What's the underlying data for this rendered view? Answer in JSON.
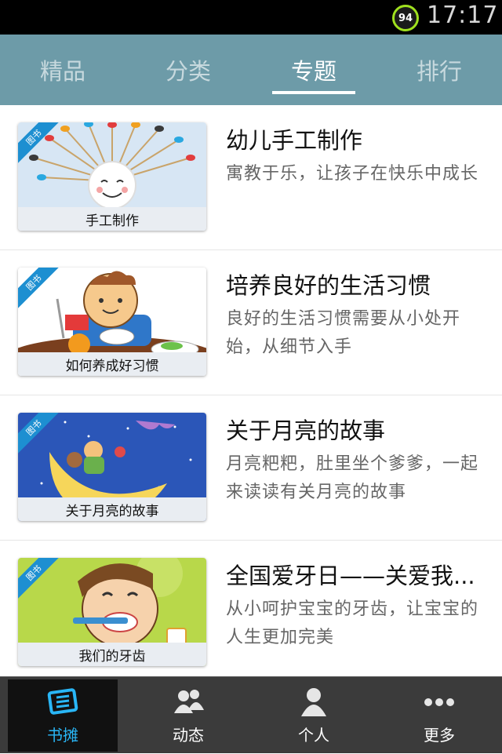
{
  "status": {
    "battery": "94",
    "time": "17:17"
  },
  "tabs": [
    {
      "label": "精品",
      "active": false
    },
    {
      "label": "分类",
      "active": false
    },
    {
      "label": "专题",
      "active": true
    },
    {
      "label": "排行",
      "active": false
    }
  ],
  "ribbon_label": "图书",
  "items": [
    {
      "caption": "手工制作",
      "title": "幼儿手工制作",
      "desc": "寓教于乐，让孩子在快乐中成长"
    },
    {
      "caption": "如何养成好习惯",
      "title": "培养良好的生活习惯",
      "desc": "良好的生活习惯需要从小处开始，从细节入手"
    },
    {
      "caption": "关于月亮的故事",
      "title": "关于月亮的故事",
      "desc": "月亮粑粑，肚里坐个爹爹，一起来读读有关月亮的故事"
    },
    {
      "caption": "我们的牙齿",
      "title": "全国爱牙日——关爱我...",
      "desc": "从小呵护宝宝的牙齿，让宝宝的人生更加完美"
    }
  ],
  "bottom_nav": [
    {
      "label": "书摊",
      "icon": "book-stall-icon",
      "active": true
    },
    {
      "label": "动态",
      "icon": "people-icon",
      "active": false
    },
    {
      "label": "个人",
      "icon": "person-icon",
      "active": false
    },
    {
      "label": "更多",
      "icon": "more-icon",
      "active": false
    }
  ],
  "colors": {
    "tabbar": "#6d9ba8",
    "ribbon": "#1d8fd1",
    "active_nav": "#29b6f6"
  }
}
